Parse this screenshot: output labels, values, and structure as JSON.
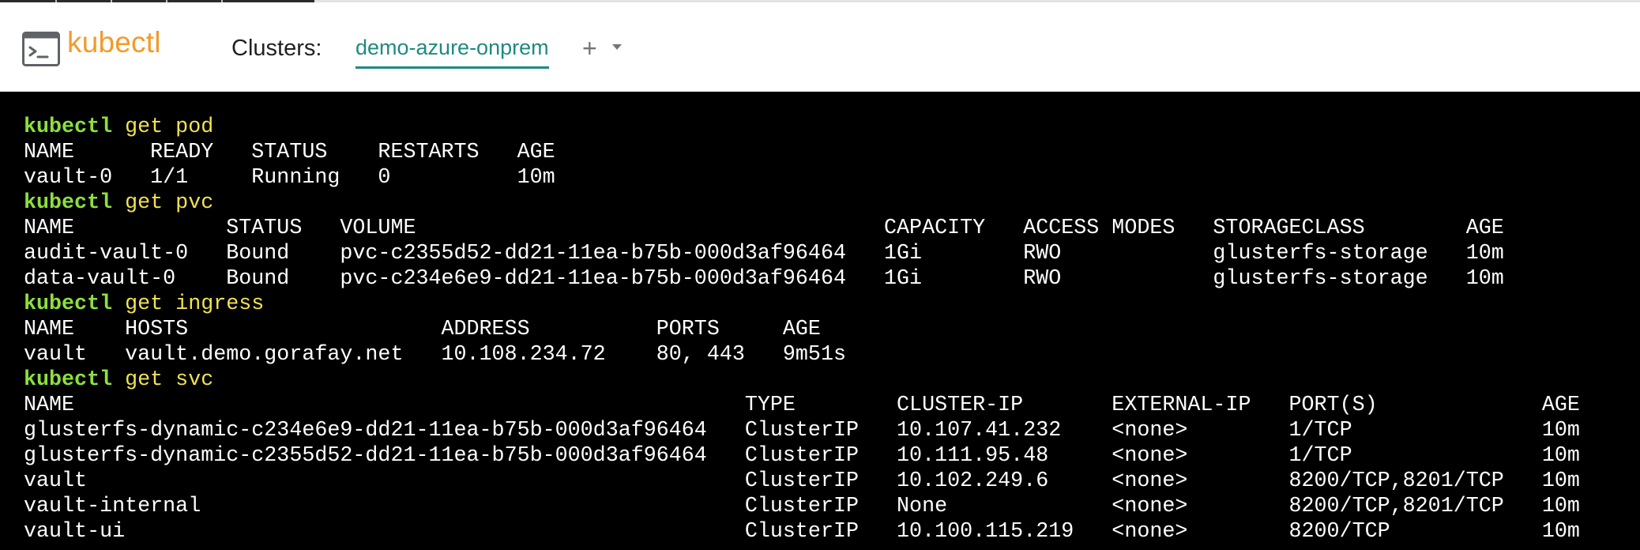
{
  "header": {
    "brand": "kubectl",
    "logo_icon": "terminal-prompt-icon",
    "clusters_label": "Clusters:",
    "active_cluster": "demo-azure-onprem",
    "add_button": "+",
    "menu_icon": "caret-down-icon",
    "accent_color": "#1f8a7f",
    "brand_color": "#f39a2b"
  },
  "terminal": {
    "command_color": "#8de03c",
    "args_color": "#f0e34f",
    "lines": [
      {
        "type": "command",
        "command": "kubectl",
        "args": " get pod"
      },
      {
        "type": "output",
        "text": "NAME      READY   STATUS    RESTARTS   AGE"
      },
      {
        "type": "output",
        "text": "vault-0   1/1     Running   0          10m"
      },
      {
        "type": "command",
        "command": "kubectl",
        "args": " get pvc"
      },
      {
        "type": "output",
        "text": "NAME            STATUS   VOLUME                                     CAPACITY   ACCESS MODES   STORAGECLASS        AGE"
      },
      {
        "type": "output",
        "text": "audit-vault-0   Bound    pvc-c2355d52-dd21-11ea-b75b-000d3af96464   1Gi        RWO            glusterfs-storage   10m"
      },
      {
        "type": "output",
        "text": "data-vault-0    Bound    pvc-c234e6e9-dd21-11ea-b75b-000d3af96464   1Gi        RWO            glusterfs-storage   10m"
      },
      {
        "type": "command",
        "command": "kubectl",
        "args": " get ingress"
      },
      {
        "type": "output",
        "text": "NAME    HOSTS                    ADDRESS          PORTS     AGE"
      },
      {
        "type": "output",
        "text": "vault   vault.demo.gorafay.net   10.108.234.72    80, 443   9m51s"
      },
      {
        "type": "command",
        "command": "kubectl",
        "args": " get svc"
      },
      {
        "type": "output",
        "text": "NAME                                                     TYPE        CLUSTER-IP       EXTERNAL-IP   PORT(S)             AGE"
      },
      {
        "type": "output",
        "text": "glusterfs-dynamic-c234e6e9-dd21-11ea-b75b-000d3af96464   ClusterIP   10.107.41.232    <none>        1/TCP               10m"
      },
      {
        "type": "output",
        "text": "glusterfs-dynamic-c2355d52-dd21-11ea-b75b-000d3af96464   ClusterIP   10.111.95.48     <none>        1/TCP               10m"
      },
      {
        "type": "output",
        "text": "vault                                                    ClusterIP   10.102.249.6     <none>        8200/TCP,8201/TCP   10m"
      },
      {
        "type": "output",
        "text": "vault-internal                                           ClusterIP   None             <none>        8200/TCP,8201/TCP   10m"
      },
      {
        "type": "output",
        "text": "vault-ui                                                 ClusterIP   10.100.115.219   <none>        8200/TCP            10m"
      }
    ]
  }
}
